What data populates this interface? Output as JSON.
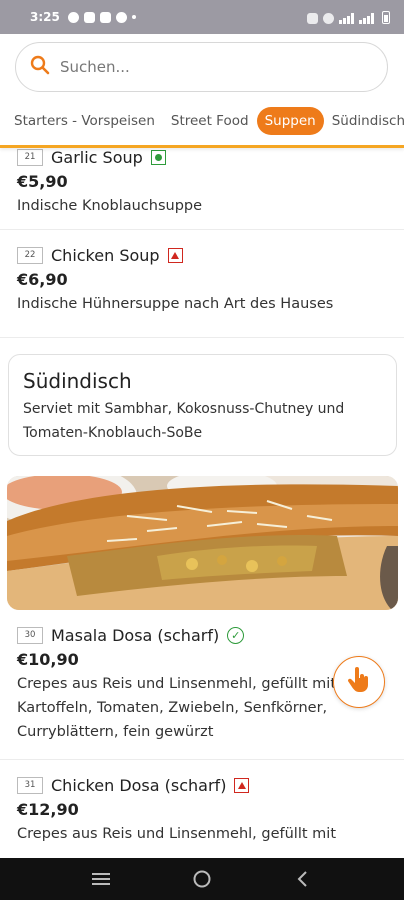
{
  "status_bar": {
    "time": "3:25"
  },
  "search": {
    "placeholder": "Suchen..."
  },
  "tabs": [
    {
      "label": "Starters - Vorspeisen",
      "active": false
    },
    {
      "label": "Street Food",
      "active": false
    },
    {
      "label": "Suppen",
      "active": true
    },
    {
      "label": "Südindisch",
      "active": false
    }
  ],
  "items_top": [
    {
      "number": "21",
      "name": "Garlic Soup",
      "diet": "vegetarian-icon",
      "price": "€5,90",
      "description": "Indische Knoblauchsuppe"
    },
    {
      "number": "22",
      "name": "Chicken Soup",
      "diet": "non-vegetarian-icon",
      "price": "€6,90",
      "description": "Indische Hühnersuppe nach Art des Hauses"
    }
  ],
  "section": {
    "title": "Südindisch",
    "description": "Serviet mit Sambhar, Kokosnuss-Chutney und Tomaten-Knoblauch-SoBe"
  },
  "items_bottom": [
    {
      "number": "30",
      "name": "Masala Dosa (scharf)",
      "diet": "vegan-icon",
      "price": "€10,90",
      "description": "Crepes aus Reis und Linsenmehl, gefüllt mit Kartoffeln, Tomaten, Zwiebeln, Senfkörner, Curryblättern, fein gewürzt"
    },
    {
      "number": "31",
      "name": "Chicken Dosa (scharf)",
      "diet": "non-vegetarian-icon",
      "price": "€12,90",
      "description": "Crepes aus Reis und Linsenmehl, gefüllt mit"
    }
  ],
  "colors": {
    "accent": "#ee7b1a",
    "header_border": "#f5a623",
    "veg": "#2e9b3b",
    "nonveg": "#d0281f"
  },
  "icons": {
    "search": "search-icon",
    "fab": "hand-pointer-icon",
    "nav": [
      "menu-icon",
      "home-circle-icon",
      "back-icon"
    ]
  }
}
